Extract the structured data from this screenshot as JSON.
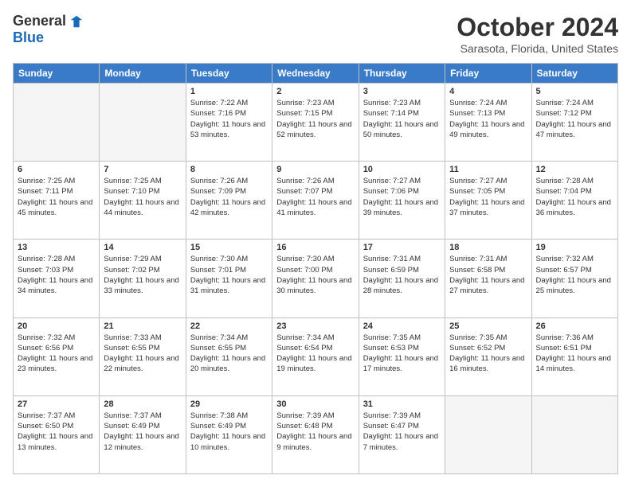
{
  "logo": {
    "general": "General",
    "blue": "Blue"
  },
  "title": "October 2024",
  "subtitle": "Sarasota, Florida, United States",
  "days_of_week": [
    "Sunday",
    "Monday",
    "Tuesday",
    "Wednesday",
    "Thursday",
    "Friday",
    "Saturday"
  ],
  "weeks": [
    [
      {
        "day": "",
        "info": ""
      },
      {
        "day": "",
        "info": ""
      },
      {
        "day": "1",
        "info": "Sunrise: 7:22 AM\nSunset: 7:16 PM\nDaylight: 11 hours and 53 minutes."
      },
      {
        "day": "2",
        "info": "Sunrise: 7:23 AM\nSunset: 7:15 PM\nDaylight: 11 hours and 52 minutes."
      },
      {
        "day": "3",
        "info": "Sunrise: 7:23 AM\nSunset: 7:14 PM\nDaylight: 11 hours and 50 minutes."
      },
      {
        "day": "4",
        "info": "Sunrise: 7:24 AM\nSunset: 7:13 PM\nDaylight: 11 hours and 49 minutes."
      },
      {
        "day": "5",
        "info": "Sunrise: 7:24 AM\nSunset: 7:12 PM\nDaylight: 11 hours and 47 minutes."
      }
    ],
    [
      {
        "day": "6",
        "info": "Sunrise: 7:25 AM\nSunset: 7:11 PM\nDaylight: 11 hours and 45 minutes."
      },
      {
        "day": "7",
        "info": "Sunrise: 7:25 AM\nSunset: 7:10 PM\nDaylight: 11 hours and 44 minutes."
      },
      {
        "day": "8",
        "info": "Sunrise: 7:26 AM\nSunset: 7:09 PM\nDaylight: 11 hours and 42 minutes."
      },
      {
        "day": "9",
        "info": "Sunrise: 7:26 AM\nSunset: 7:07 PM\nDaylight: 11 hours and 41 minutes."
      },
      {
        "day": "10",
        "info": "Sunrise: 7:27 AM\nSunset: 7:06 PM\nDaylight: 11 hours and 39 minutes."
      },
      {
        "day": "11",
        "info": "Sunrise: 7:27 AM\nSunset: 7:05 PM\nDaylight: 11 hours and 37 minutes."
      },
      {
        "day": "12",
        "info": "Sunrise: 7:28 AM\nSunset: 7:04 PM\nDaylight: 11 hours and 36 minutes."
      }
    ],
    [
      {
        "day": "13",
        "info": "Sunrise: 7:28 AM\nSunset: 7:03 PM\nDaylight: 11 hours and 34 minutes."
      },
      {
        "day": "14",
        "info": "Sunrise: 7:29 AM\nSunset: 7:02 PM\nDaylight: 11 hours and 33 minutes."
      },
      {
        "day": "15",
        "info": "Sunrise: 7:30 AM\nSunset: 7:01 PM\nDaylight: 11 hours and 31 minutes."
      },
      {
        "day": "16",
        "info": "Sunrise: 7:30 AM\nSunset: 7:00 PM\nDaylight: 11 hours and 30 minutes."
      },
      {
        "day": "17",
        "info": "Sunrise: 7:31 AM\nSunset: 6:59 PM\nDaylight: 11 hours and 28 minutes."
      },
      {
        "day": "18",
        "info": "Sunrise: 7:31 AM\nSunset: 6:58 PM\nDaylight: 11 hours and 27 minutes."
      },
      {
        "day": "19",
        "info": "Sunrise: 7:32 AM\nSunset: 6:57 PM\nDaylight: 11 hours and 25 minutes."
      }
    ],
    [
      {
        "day": "20",
        "info": "Sunrise: 7:32 AM\nSunset: 6:56 PM\nDaylight: 11 hours and 23 minutes."
      },
      {
        "day": "21",
        "info": "Sunrise: 7:33 AM\nSunset: 6:55 PM\nDaylight: 11 hours and 22 minutes."
      },
      {
        "day": "22",
        "info": "Sunrise: 7:34 AM\nSunset: 6:55 PM\nDaylight: 11 hours and 20 minutes."
      },
      {
        "day": "23",
        "info": "Sunrise: 7:34 AM\nSunset: 6:54 PM\nDaylight: 11 hours and 19 minutes."
      },
      {
        "day": "24",
        "info": "Sunrise: 7:35 AM\nSunset: 6:53 PM\nDaylight: 11 hours and 17 minutes."
      },
      {
        "day": "25",
        "info": "Sunrise: 7:35 AM\nSunset: 6:52 PM\nDaylight: 11 hours and 16 minutes."
      },
      {
        "day": "26",
        "info": "Sunrise: 7:36 AM\nSunset: 6:51 PM\nDaylight: 11 hours and 14 minutes."
      }
    ],
    [
      {
        "day": "27",
        "info": "Sunrise: 7:37 AM\nSunset: 6:50 PM\nDaylight: 11 hours and 13 minutes."
      },
      {
        "day": "28",
        "info": "Sunrise: 7:37 AM\nSunset: 6:49 PM\nDaylight: 11 hours and 12 minutes."
      },
      {
        "day": "29",
        "info": "Sunrise: 7:38 AM\nSunset: 6:49 PM\nDaylight: 11 hours and 10 minutes."
      },
      {
        "day": "30",
        "info": "Sunrise: 7:39 AM\nSunset: 6:48 PM\nDaylight: 11 hours and 9 minutes."
      },
      {
        "day": "31",
        "info": "Sunrise: 7:39 AM\nSunset: 6:47 PM\nDaylight: 11 hours and 7 minutes."
      },
      {
        "day": "",
        "info": ""
      },
      {
        "day": "",
        "info": ""
      }
    ]
  ]
}
